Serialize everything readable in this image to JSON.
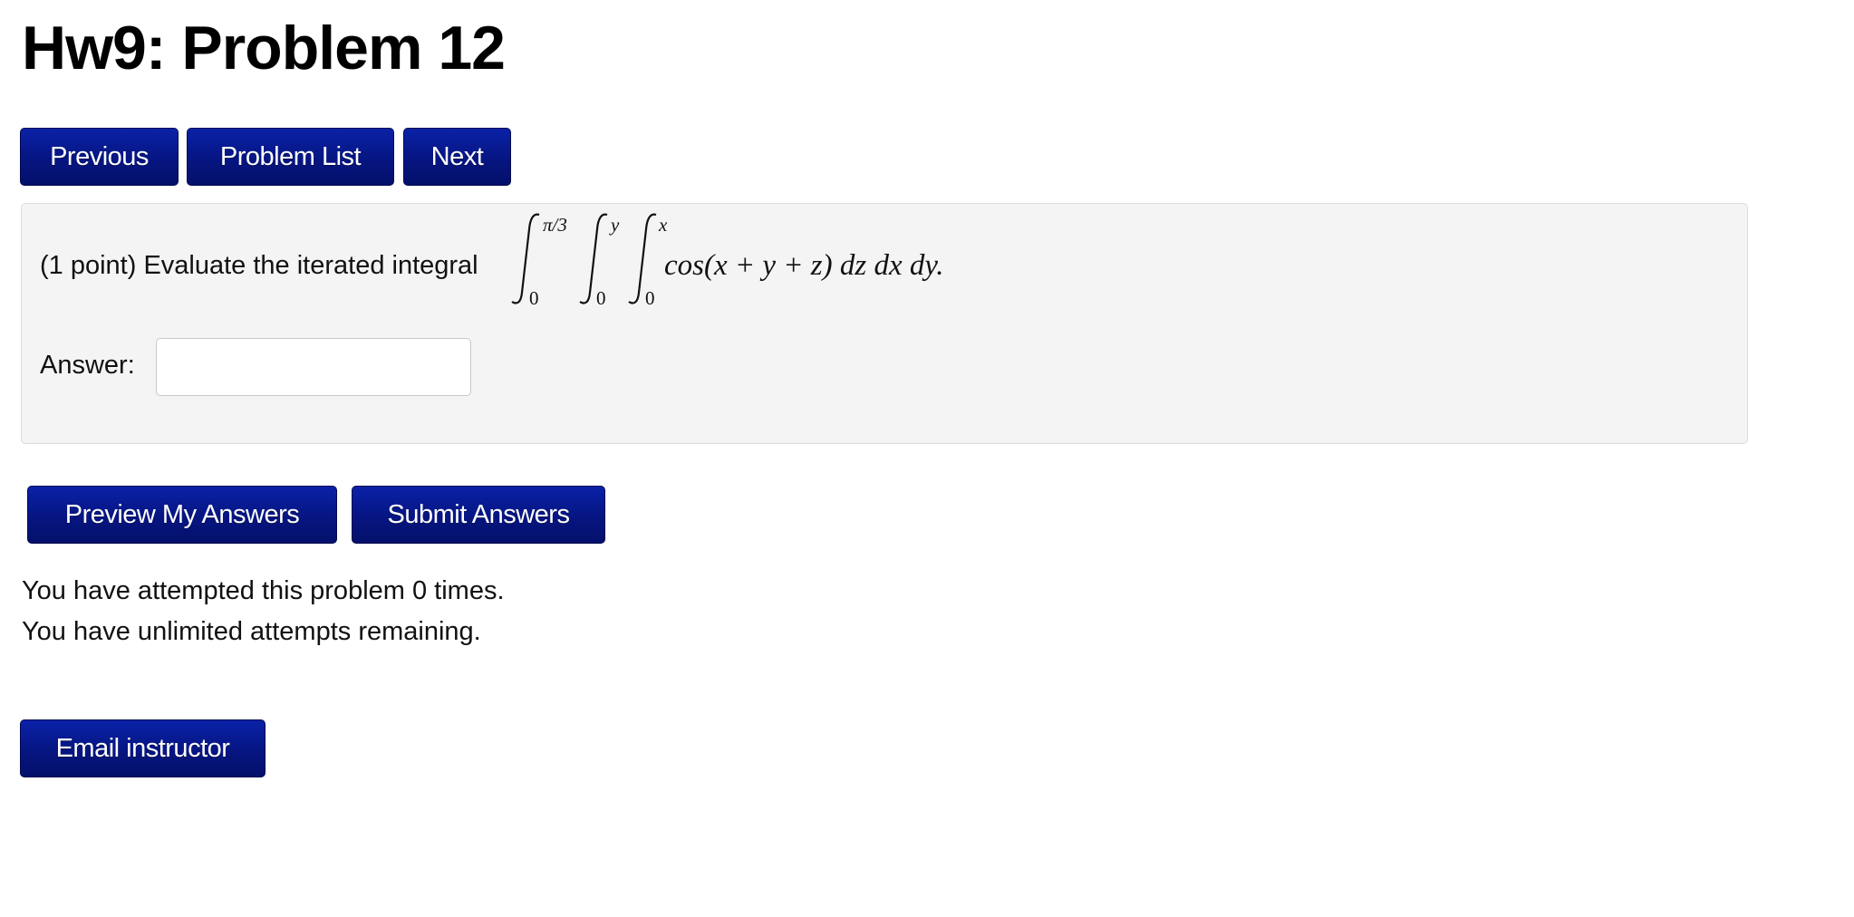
{
  "page": {
    "title": "Hw9: Problem 12"
  },
  "nav": {
    "previous_label": "Previous",
    "problem_list_label": "Problem List",
    "next_label": "Next"
  },
  "problem": {
    "prefix_text": "(1 point) Evaluate the iterated integral",
    "math": {
      "int1_upper": "π/3",
      "int1_lower": "0",
      "int2_upper": "y",
      "int2_lower": "0",
      "int3_upper": "x",
      "int3_lower": "0",
      "integrand": "cos(x + y + z) dz dx dy."
    },
    "answer_label": "Answer:",
    "answer_value": ""
  },
  "actions": {
    "preview_label": "Preview My Answers",
    "submit_label": "Submit Answers"
  },
  "status": {
    "attempts_line": "You have attempted this problem 0 times.",
    "remaining_line": "You have unlimited attempts remaining."
  },
  "footer": {
    "email_label": "Email instructor"
  },
  "colors": {
    "button_bg": "#061581",
    "panel_bg": "#f4f4f4"
  }
}
